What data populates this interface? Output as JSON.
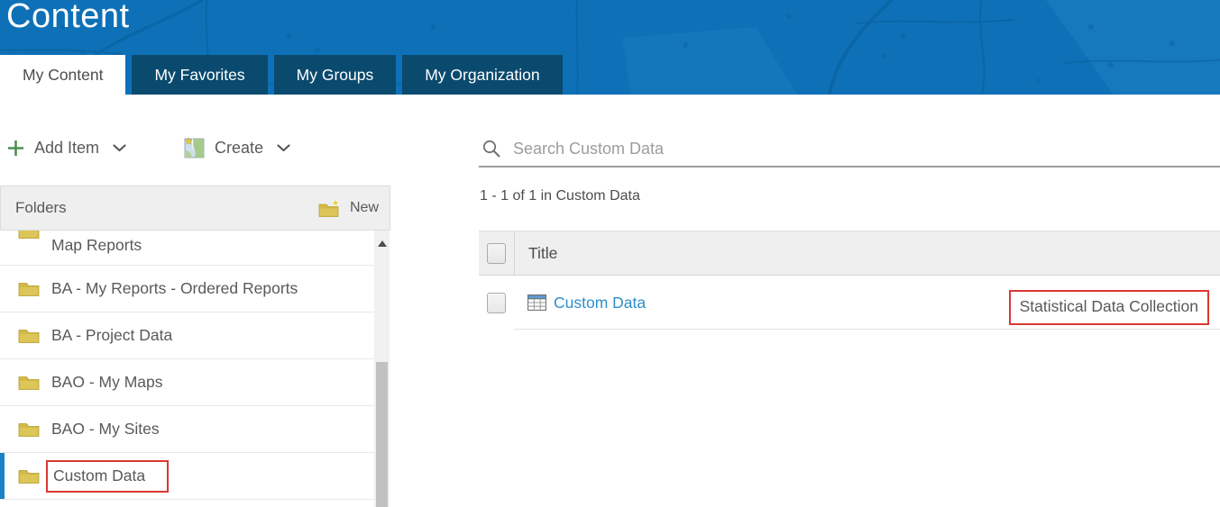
{
  "header": {
    "title": "Content",
    "tabs": [
      {
        "label": "My Content",
        "active": true
      },
      {
        "label": "My Favorites",
        "active": false
      },
      {
        "label": "My Groups",
        "active": false
      },
      {
        "label": "My Organization",
        "active": false
      }
    ]
  },
  "toolbar": {
    "add_item_label": "Add Item",
    "create_label": "Create"
  },
  "folders_panel": {
    "title": "Folders",
    "new_label": "New",
    "items": [
      {
        "label": "Map Reports",
        "selected": false,
        "annotated": false
      },
      {
        "label": "BA - My Reports - Ordered Reports",
        "selected": false,
        "annotated": false
      },
      {
        "label": "BA - Project Data",
        "selected": false,
        "annotated": false
      },
      {
        "label": "BAO - My Maps",
        "selected": false,
        "annotated": false
      },
      {
        "label": "BAO - My Sites",
        "selected": false,
        "annotated": false
      },
      {
        "label": "Custom Data",
        "selected": true,
        "annotated": true
      }
    ]
  },
  "main": {
    "search_placeholder": "Search Custom Data",
    "results_summary": "1 - 1 of 1 in Custom Data",
    "table": {
      "title_column": "Title",
      "row": {
        "title": "Custom Data",
        "annotation": "Statistical Data Collection"
      }
    }
  },
  "colors": {
    "header_blue": "#0e71b7",
    "tab_inactive": "#0a4a6e",
    "link_blue": "#2e8fc9",
    "annotation_red": "#da3832",
    "folder_yellow": "#d5bd4d",
    "selected_indicator": "#1c82c5",
    "text_gray": "#595959"
  }
}
